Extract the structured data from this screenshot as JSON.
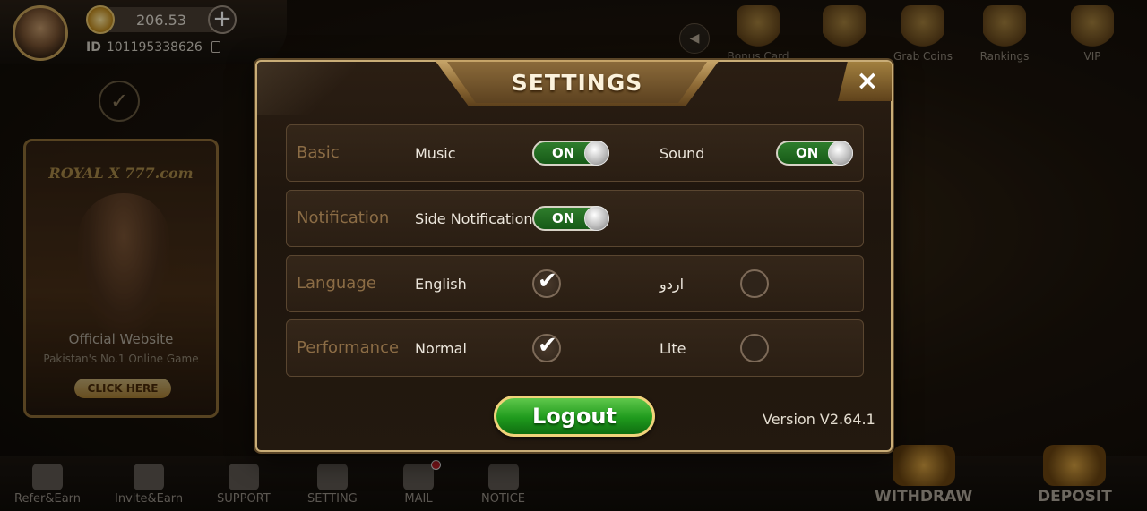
{
  "player": {
    "balance": "206.53",
    "id_label": "ID",
    "id_value": "101195338626"
  },
  "promo": {
    "logo": "ROYAL X 777.com",
    "title": "Official Website",
    "subtitle": "Pakistan's No.1 Online Game",
    "cta": "CLICK HERE"
  },
  "top_nav": [
    {
      "label": "Bonus Card",
      "icon": "bonus-card-icon"
    },
    {
      "label": "",
      "icon": "trophy-icon"
    },
    {
      "label": "Grab Coins",
      "icon": "grab-coins-icon"
    },
    {
      "label": "Rankings",
      "icon": "rankings-icon"
    },
    {
      "label": "VIP",
      "icon": "vip-icon"
    }
  ],
  "bottom_nav": [
    {
      "label": "Refer&Earn",
      "icon": "refer-earn-icon"
    },
    {
      "label": "Invite&Earn",
      "icon": "invite-earn-icon"
    },
    {
      "label": "SUPPORT",
      "icon": "support-icon"
    },
    {
      "label": "SETTING",
      "icon": "setting-icon"
    },
    {
      "label": "MAIL",
      "icon": "mail-icon",
      "badge": "1"
    },
    {
      "label": "NOTICE",
      "icon": "notice-icon"
    },
    {
      "label": "WITHDRAW",
      "icon": "withdraw-icon"
    },
    {
      "label": "DEPOSIT",
      "icon": "deposit-icon"
    }
  ],
  "settings": {
    "title": "SETTINGS",
    "close_label": "×",
    "basic": {
      "label": "Basic",
      "music_label": "Music",
      "music_state": "ON",
      "sound_label": "Sound",
      "sound_state": "ON"
    },
    "notification": {
      "label": "Notification",
      "side_label": "Side Notification",
      "side_state": "ON"
    },
    "language": {
      "label": "Language",
      "options": [
        {
          "label": "English",
          "selected": true
        },
        {
          "label": "اردو",
          "selected": false
        }
      ]
    },
    "performance": {
      "label": "Performance",
      "options": [
        {
          "label": "Normal",
          "selected": true
        },
        {
          "label": "Lite",
          "selected": false
        }
      ]
    },
    "logout_label": "Logout",
    "version": "Version  V2.64.1"
  },
  "colors": {
    "toggle_on": "#2f7d2c",
    "logout_green": "#1f9a1d",
    "gold_border": "#c9ad77",
    "row_label": "#8b6c45"
  }
}
